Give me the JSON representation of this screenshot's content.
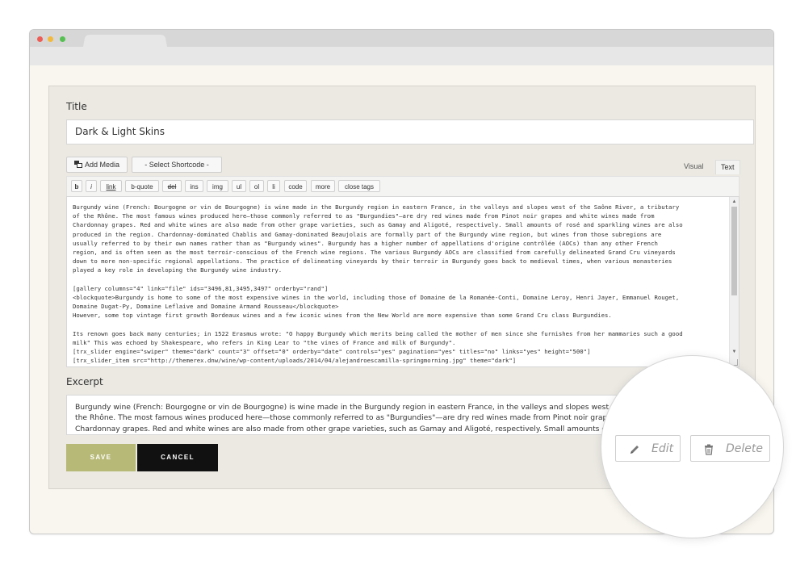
{
  "form": {
    "title_label": "Title",
    "title_value": "Dark & Light Skins",
    "add_media_label": "Add Media",
    "shortcode_label": "- Select Shortcode -",
    "tab_visual": "Visual",
    "tab_text": "Text",
    "quicktags": [
      "b",
      "i",
      "link",
      "b-quote",
      "del",
      "ins",
      "img",
      "ul",
      "ol",
      "li",
      "code",
      "more",
      "close tags"
    ],
    "content": "Burgundy wine (French: Bourgogne or vin de Bourgogne) is wine made in the Burgundy region in eastern France, in the valleys and slopes west of the Saône River, a tributary\nof the Rhône. The most famous wines produced here—those commonly referred to as \"Burgundies\"—are dry red wines made from Pinot noir grapes and white wines made from\nChardonnay grapes. Red and white wines are also made from other grape varieties, such as Gamay and Aligoté, respectively. Small amounts of rosé and sparkling wines are also\nproduced in the region. Chardonnay-dominated Chablis and Gamay-dominated Beaujolais are formally part of the Burgundy wine region, but wines from those subregions are\nusually referred to by their own names rather than as \"Burgundy wines\". Burgundy has a higher number of appellations d'origine contrôlée (AOCs) than any other French\nregion, and is often seen as the most terroir-conscious of the French wine regions. The various Burgundy AOCs are classified from carefully delineated Grand Cru vineyards\ndown to more non-specific regional appellations. The practice of delineating vineyards by their terroir in Burgundy goes back to medieval times, when various monasteries\nplayed a key role in developing the Burgundy wine industry.\n\n[gallery columns=\"4\" link=\"file\" ids=\"3496,81,3495,3497\" orderby=\"rand\"]\n<blockquote>Burgundy is home to some of the most expensive wines in the world, including those of Domaine de la Romanée-Conti, Domaine Leroy, Henri Jayer, Emmanuel Rouget,\nDomaine Dugat-Py, Domaine Leflaive and Domaine Armand Rousseau</blockquote>\nHowever, some top vintage first growth Bordeaux wines and a few iconic wines from the New World are more expensive than some Grand Cru class Burgundies.\n\nIts renown goes back many centuries; in 1522 Erasmus wrote: \"O happy Burgundy which merits being called the mother of men since she furnishes from her mammaries such a good\nmilk\" This was echoed by Shakespeare, who refers in King Lear to \"the vines of France and milk of Burgundy\".\n[trx_slider engine=\"swiper\" theme=\"dark\" count=\"3\" offset=\"0\" orderby=\"date\" controls=\"yes\" pagination=\"yes\" titles=\"no\" links=\"yes\" height=\"500\"]\n[trx_slider_item src=\"http://themerex.dnw/wine/wp-content/uploads/2014/04/alejandroescamilla-springmorning.jpg\" theme=\"dark\"]",
    "excerpt_label": "Excerpt",
    "excerpt_value": "Burgundy wine (French: Bourgogne or vin de Bourgogne) is wine made in the Burgundy region in eastern France, in the valleys and slopes west of the S\nthe Rhône. The most famous wines produced here—those commonly referred to as \"Burgundies\"—are dry red wines made from Pinot noir grapes and\nChardonnay grapes. Red and white wines are also made from other grape varieties, such as Gamay and Aligoté, respectively. Small amounts of rosé a",
    "save_label": "SAVE",
    "cancel_label": "CANCEL"
  },
  "magnifier": {
    "edit_label": "Edit",
    "delete_label": "Delete",
    "edit_icon": "pencil-icon",
    "delete_icon": "trash-icon"
  },
  "colors": {
    "save_bg": "#b7b977",
    "cancel_bg": "#111111",
    "page_bg": "#f8f6ef"
  }
}
